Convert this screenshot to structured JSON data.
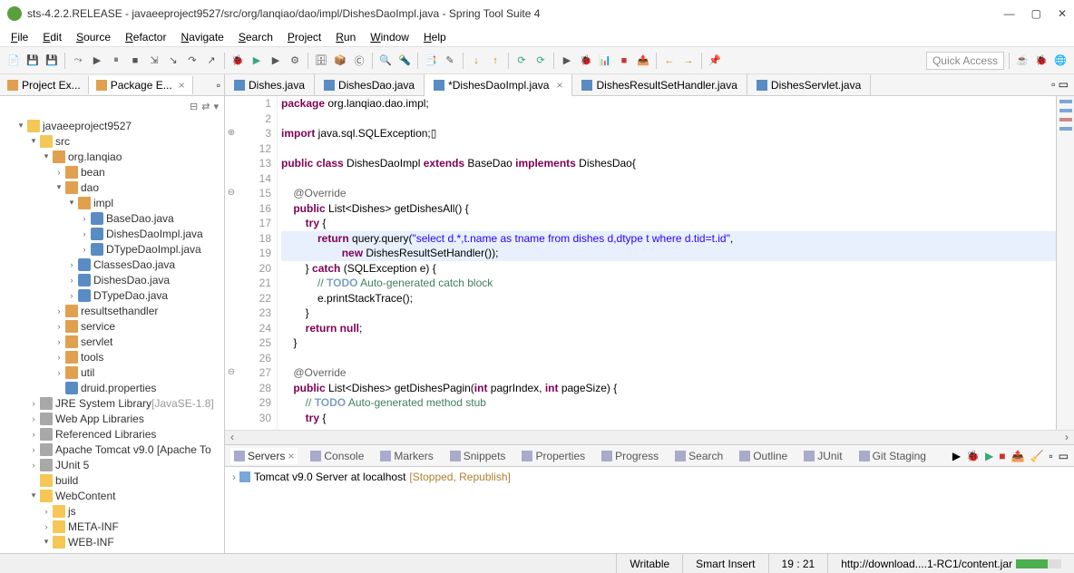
{
  "window": {
    "title": "sts-4.2.2.RELEASE - javaeeproject9527/src/org/lanqiao/dao/impl/DishesDaoImpl.java - Spring Tool Suite 4"
  },
  "menu": [
    "File",
    "Edit",
    "Source",
    "Refactor",
    "Navigate",
    "Search",
    "Project",
    "Run",
    "Window",
    "Help"
  ],
  "quick_access": "Quick Access",
  "left_views": {
    "project_explorer": "Project Ex...",
    "package_explorer": "Package E..."
  },
  "tree": {
    "project": "javaeeproject9527",
    "src": "src",
    "pkg": "org.lanqiao",
    "bean": "bean",
    "dao": "dao",
    "impl": "impl",
    "files": {
      "base": "BaseDao.java",
      "dishesImpl": "DishesDaoImpl.java",
      "dtypeImpl": "DTypeDaoImpl.java",
      "classesDao": "ClassesDao.java",
      "dishesDao": "DishesDao.java",
      "dtypeDao": "DTypeDao.java"
    },
    "folders": {
      "resultset": "resultsethandler",
      "service": "service",
      "servlet": "servlet",
      "tools": "tools",
      "util": "util",
      "druid": "druid.properties",
      "jre": "JRE System Library",
      "jre_ver": "[JavaSE-1.8]",
      "web_lib": "Web App Libraries",
      "ref_lib": "Referenced Libraries",
      "tomcat": "Apache Tomcat v9.0 [Apache To",
      "junit": "JUnit 5",
      "build": "build",
      "webcontent": "WebContent",
      "js": "js",
      "meta": "META-INF",
      "webinf": "WEB-INF"
    }
  },
  "editor_tabs": [
    {
      "label": "Dishes.java",
      "dirty": false,
      "active": false
    },
    {
      "label": "DishesDao.java",
      "dirty": false,
      "active": false
    },
    {
      "label": "*DishesDaoImpl.java",
      "dirty": true,
      "active": true
    },
    {
      "label": "DishesResultSetHandler.java",
      "dirty": false,
      "active": false
    },
    {
      "label": "DishesServlet.java",
      "dirty": false,
      "active": false
    }
  ],
  "code": {
    "lines": [
      {
        "n": 1,
        "html": "<span class='kw'>package</span> org.lanqiao.dao.impl;"
      },
      {
        "n": 2,
        "html": ""
      },
      {
        "n": 3,
        "prefix": "⊕",
        "html": "<span class='kw'>import</span> java.sql.SQLException;▯"
      },
      {
        "n": 12,
        "html": ""
      },
      {
        "n": 13,
        "html": "<span class='kw'>public class</span> DishesDaoImpl <span class='kw'>extends</span> BaseDao <span class='kw'>implements</span> DishesDao{"
      },
      {
        "n": 14,
        "html": ""
      },
      {
        "n": 15,
        "prefix": "⊖",
        "html": "    <span class='ann'>@Override</span>"
      },
      {
        "n": 16,
        "html": "    <span class='kw'>public</span> List&lt;Dishes&gt; getDishesAll() {"
      },
      {
        "n": 17,
        "html": "        <span class='kw'>try</span> {"
      },
      {
        "n": 18,
        "hl": true,
        "html": "            <span class='kw'>return</span> query.query(<span class='str'>\"select d.*,t.name as tname from dishes d,dtype t where d.tid=t.id\"</span>,"
      },
      {
        "n": 19,
        "hl": true,
        "html": "                    <span class='kw'>new</span> DishesResultSetHandler());"
      },
      {
        "n": 20,
        "html": "        } <span class='kw'>catch</span> (SQLException e) {"
      },
      {
        "n": 21,
        "html": "            <span class='com'>// </span><span class='todo'>TODO</span><span class='com'> Auto-generated catch block</span>"
      },
      {
        "n": 22,
        "html": "            e.printStackTrace();"
      },
      {
        "n": 23,
        "html": "        }"
      },
      {
        "n": 24,
        "html": "        <span class='kw'>return null</span>;"
      },
      {
        "n": 25,
        "html": "    }"
      },
      {
        "n": 26,
        "html": ""
      },
      {
        "n": 27,
        "prefix": "⊖",
        "html": "    <span class='ann'>@Override</span>"
      },
      {
        "n": 28,
        "html": "    <span class='kw'>public</span> List&lt;Dishes&gt; getDishesPagin(<span class='kw'>int</span> pagrIndex, <span class='kw'>int</span> pageSize) {"
      },
      {
        "n": 29,
        "html": "        <span class='com'>// </span><span class='todo'>TODO</span><span class='com'> Auto-generated method stub</span>"
      },
      {
        "n": 30,
        "html": "        <span class='kw'>try</span> {"
      }
    ]
  },
  "bottom_tabs": [
    "Servers",
    "Console",
    "Markers",
    "Snippets",
    "Properties",
    "Progress",
    "Search",
    "Outline",
    "JUnit",
    "Git Staging"
  ],
  "server": {
    "name": "Tomcat v9.0 Server at localhost",
    "status": "[Stopped, Republish]"
  },
  "status": {
    "writable": "Writable",
    "insert": "Smart Insert",
    "pos": "19 : 21",
    "download": "http://download....1-RC1/content.jar"
  }
}
